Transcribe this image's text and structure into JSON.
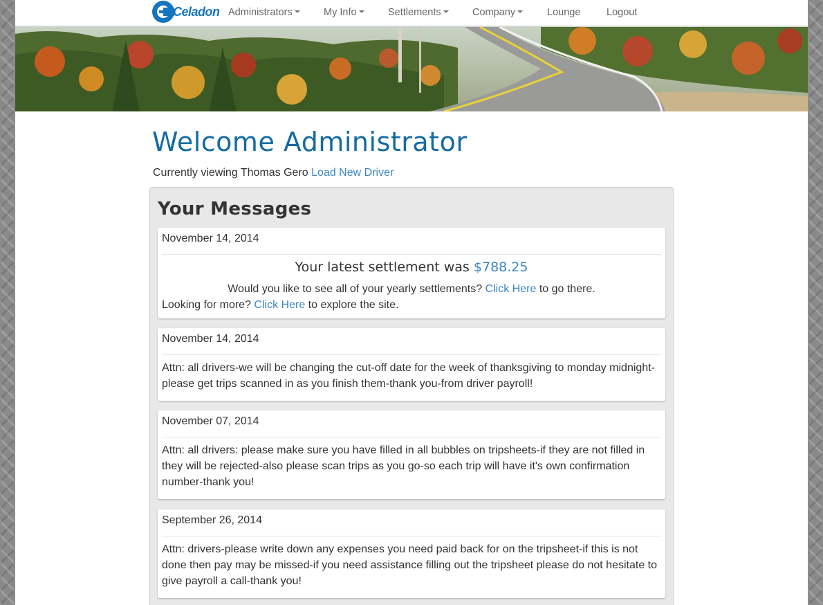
{
  "nav": {
    "brand": "Celadon",
    "items": [
      {
        "label": "Administrators",
        "dropdown": true
      },
      {
        "label": "My Info",
        "dropdown": true
      },
      {
        "label": "Settlements",
        "dropdown": true
      },
      {
        "label": "Company",
        "dropdown": true
      },
      {
        "label": "Lounge",
        "dropdown": false
      },
      {
        "label": "Logout",
        "dropdown": false
      }
    ]
  },
  "header": {
    "title": "Welcome Administrator",
    "viewing_prefix": "Currently viewing Thomas Gero",
    "load_driver_link": "Load New Driver"
  },
  "messages_panel": {
    "title": "Your Messages",
    "settlement_card": {
      "date": "November 14, 2014",
      "settlement_prefix": "Your latest settlement was",
      "settlement_amount": "$788.25",
      "yearly_prefix": "Would you like to see all of your yearly settlements?",
      "yearly_link": "Click Here",
      "yearly_suffix": "to go there.",
      "more_prefix": "Looking for more?",
      "more_link": "Click Here",
      "more_suffix": "to explore the site."
    },
    "messages": [
      {
        "date": "November 14, 2014",
        "body": "Attn: all drivers-we will be changing the cut-off date for the week of thanksgiving to monday midnight-please get trips scanned in as you finish them-thank you-from driver payroll!"
      },
      {
        "date": "November 07, 2014",
        "body": "Attn: all drivers: please make sure you have filled in all bubbles on tripsheets-if they are not filled in they will be rejected-also please scan trips as you go-so each trip will have it's own confirmation number-thank you!"
      },
      {
        "date": "September 26, 2014",
        "body": "Attn: drivers-please write down any expenses you need paid back for on the tripsheet-if this is not done then pay may be missed-if you need assistance filling out the tripsheet please do not hesitate to give payroll a call-thank you!"
      }
    ]
  },
  "colors": {
    "brand_blue": "#1575c0",
    "title_blue": "#136ba3",
    "link_blue": "#3c86c5",
    "panel_gray": "#e8e8e8"
  }
}
